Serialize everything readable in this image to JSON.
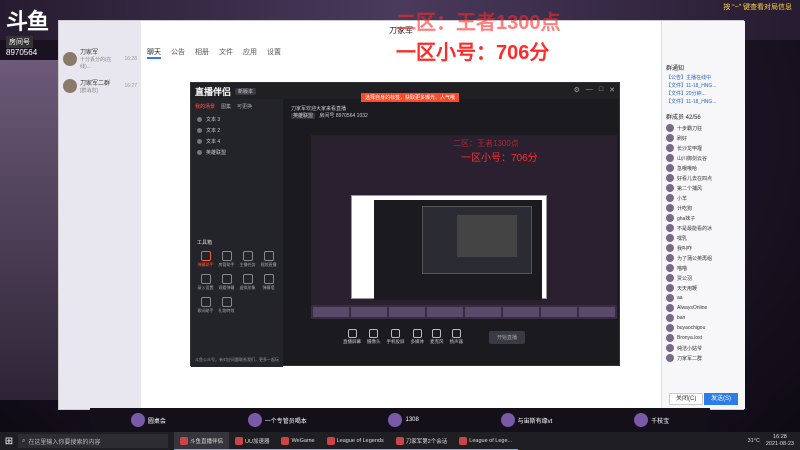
{
  "overlay": {
    "line1": "二区：王者1300点",
    "line2": "一区小号：706分"
  },
  "douyu": {
    "brand": "斗鱼",
    "room_label": "房间号",
    "room_id": "8970564"
  },
  "top_note": "按 “~” 键查看对局信息",
  "qq": {
    "title": "刀家军",
    "tabs": [
      "聊天",
      "公告",
      "相册",
      "文件",
      "应用",
      "设置"
    ],
    "contacts": [
      {
        "name": "刀家军",
        "sub": "十分丢分的(在线)...",
        "time": "16:28"
      },
      {
        "name": "刀家军二群",
        "sub": "[群消息]",
        "time": "16:27"
      }
    ],
    "right": {
      "notice_title": "群通知",
      "notices": [
        "【公告】主播在线中",
        "【文件】11-18_HNG...",
        "【文件】20分钟...",
        "【文件】11-18_HNG..."
      ],
      "members_title": "群成员 42/56",
      "members": [
        "十步霸刀狂",
        "刷好",
        "长沙龙甲堰",
        "山川御剑云谷",
        "急哦哦哈",
        "好看儿去在四点",
        "第二个捕风",
        "小羊",
        "计吃狗",
        "gha妹子",
        "不是最能看的冰",
        "嘿乳",
        "我叫咋",
        "为了蒲公英再组",
        "喵喵",
        "贾公羽",
        "天天用鞭",
        "aa",
        "AlwaysOnline",
        "ban",
        "buyaochigou",
        "Bronya.lost",
        "纯洁小姑爷",
        "刀家军二群"
      ],
      "close_label": "关闭(C)",
      "send_label": "发送(S)"
    }
  },
  "streamer": {
    "logo": "直播伴侣",
    "version": "新版本",
    "promo": "选择自身的标签，获取更多曝光、人气哦",
    "left_tabs": [
      "我的场景",
      "图集",
      "可更换"
    ],
    "scenes": [
      "文本 3",
      "文本 2",
      "文本 4",
      "英雄联盟"
    ],
    "tools_title": "工具箱",
    "tools": [
      "弹幕助手",
      "房管助手",
      "主播任务",
      "视频直播",
      "录入设置",
      "观看弹幕",
      "虚拟形象",
      "弹幕墙",
      "歌词助手",
      "礼物特效"
    ],
    "left_footer": "斗鱼公众号，有对应问题联系我们，更多一起玩",
    "info": {
      "title": "刀家军欢迎大家来看直播",
      "category": "英雄联盟",
      "room_chip": "房间号",
      "room_no": "8970564",
      "viewers": "1032"
    },
    "actions": [
      "直播屏幕",
      "摄像头",
      "手机投屏",
      "多媒体",
      "麦克风",
      "扬声器"
    ],
    "start_label": "开始直播"
  },
  "gamebar": {
    "items": [
      "圆桌会",
      "一个专管员喝本",
      "1308",
      "与宙斯有缘vt",
      "千枝宝"
    ]
  },
  "taskbar": {
    "search_placeholder": "在这里输入你要搜索的内容",
    "apps": [
      "斗鱼直播伴侣",
      "UU加速器",
      "WeGame",
      "League of Legends",
      "刀家军第2个会话",
      "League of Lege..."
    ],
    "temp": "31°C",
    "time": "16:28",
    "date": "2021-08-23"
  }
}
